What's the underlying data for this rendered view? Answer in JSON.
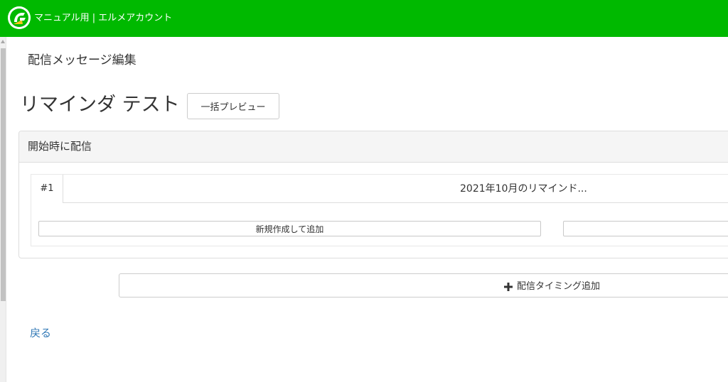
{
  "header": {
    "title": "マニュアル用 | エルメアカウント",
    "brand_color": "#00b900",
    "logo_icon": "lmessage-logo-icon"
  },
  "page": {
    "section_title": "配信メッセージ編集",
    "title": "リマインダ テスト",
    "preview_button_label": "一括プレビュー"
  },
  "panel": {
    "heading": "開始時に配信",
    "items": [
      {
        "number": "#1",
        "label": "2021年10月のリマインド..."
      }
    ],
    "new_button_label": "新規作成して追加",
    "second_button_label": ""
  },
  "add_timing": {
    "label": "配信タイミング追加",
    "icon": "plus-icon"
  },
  "footer": {
    "back_link": "戻る",
    "link_color": "#337ab7"
  }
}
